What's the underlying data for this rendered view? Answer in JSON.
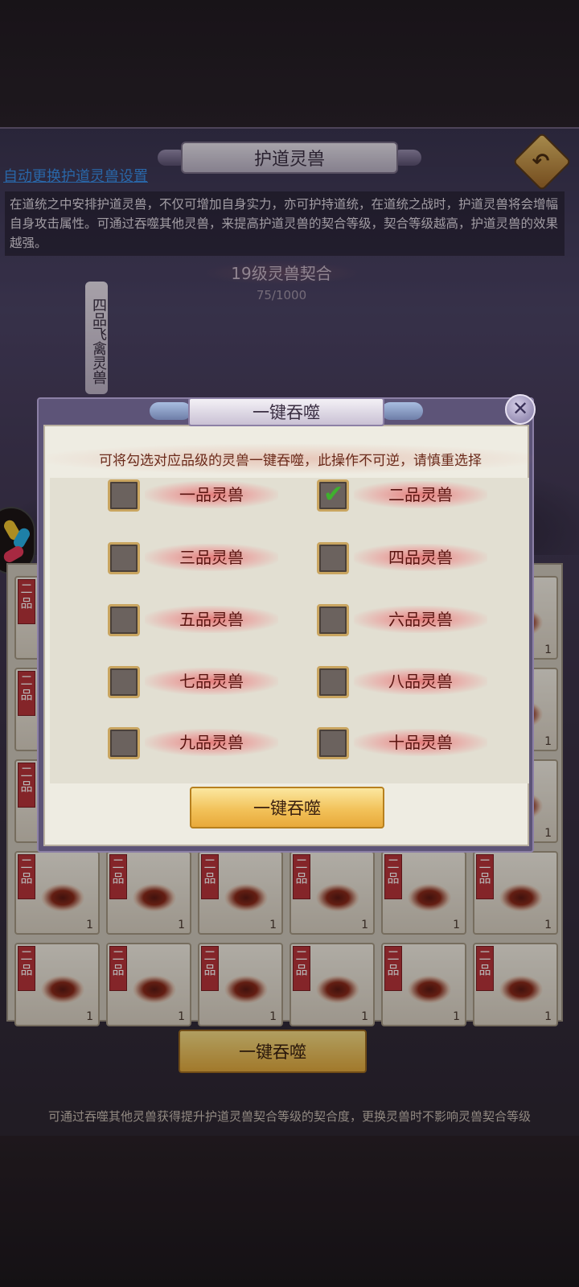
{
  "header": {
    "title": "护道灵兽",
    "auto_link": "自动更换护道灵兽设置",
    "description": "在道统之中安排护道灵兽，不仅可增加自身实力，亦可护持道统，在道统之战时，护道灵兽将会增幅自身攻击属性。可通过吞噬其他灵兽，来提高护道灵兽的契合等级，契合等级越高，护道灵兽的效果越强。"
  },
  "bond": {
    "level_title": "19级灵兽契合",
    "progress_text": "75/1000",
    "progress_value": 75,
    "progress_max": 1000,
    "beast_label": "四品飞禽灵兽"
  },
  "beast_grid": {
    "grade_tag": "二品",
    "count": "1"
  },
  "bottom": {
    "devour_button": "一键吞噬",
    "footer_note": "可通过吞噬其他灵兽获得提升护道灵兽契合等级的契合度，更换灵兽时不影响灵兽契合等级"
  },
  "dialog": {
    "title": "一键吞噬",
    "hint": "可将勾选对应品级的灵兽一键吞噬，此操作不可逆，请慎重选择",
    "options": [
      {
        "label": "一品灵兽",
        "checked": false
      },
      {
        "label": "二品灵兽",
        "checked": true
      },
      {
        "label": "三品灵兽",
        "checked": false
      },
      {
        "label": "四品灵兽",
        "checked": false
      },
      {
        "label": "五品灵兽",
        "checked": false
      },
      {
        "label": "六品灵兽",
        "checked": false
      },
      {
        "label": "七品灵兽",
        "checked": false
      },
      {
        "label": "八品灵兽",
        "checked": false
      },
      {
        "label": "九品灵兽",
        "checked": false
      },
      {
        "label": "十品灵兽",
        "checked": false
      }
    ],
    "confirm_button": "一键吞噬",
    "close_icon": "close-icon"
  },
  "colors": {
    "accent_gold": "#f2c25a",
    "tag_red": "#b7343a",
    "link_blue": "#3a8ee8",
    "check_green": "#3fb02e"
  }
}
